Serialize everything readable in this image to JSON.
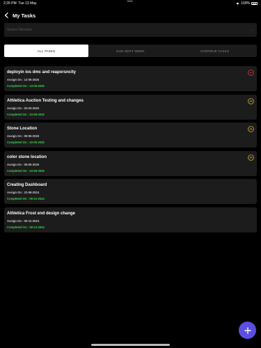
{
  "status_bar": {
    "time": "2:26 PM",
    "date": "Tue 13 May",
    "battery": "100%"
  },
  "header": {
    "title": "My Tasks"
  },
  "select_member": {
    "placeholder": "Select Member"
  },
  "tabs": [
    {
      "label": "ALL TASKS",
      "active": true
    },
    {
      "label": "DUE NEXT WEEK",
      "active": false
    },
    {
      "label": "OVERDUE TASKS",
      "active": false
    }
  ],
  "tasks": [
    {
      "title": "deployin ios dmc and reaporsncity",
      "assign": "Assign On : 12-05-2025",
      "completed": "Completed On : 13-05-2025",
      "icon": "cancel-circle-icon"
    },
    {
      "title": "Athletica Auction Testing and changes",
      "assign": "Assign On : 03-03-2025",
      "completed": "Completed On : 10-05-2025",
      "icon": "chevron-up-circle-icon"
    },
    {
      "title": "Stone Location",
      "assign": "Assign On : 09-05-2025",
      "completed": "Completed On : 10-05-2025",
      "icon": "chevron-up-circle-icon"
    },
    {
      "title": "color stone location",
      "assign": "Assign On : 09-05-2025",
      "completed": "Completed On : 10-05-2025",
      "icon": "chevron-up-circle-icon"
    },
    {
      "title": "Creating Dashboard",
      "assign": "Assign On : 22-08-2024",
      "completed": "Completed On : 09-12-2024",
      "icon": ""
    },
    {
      "title": "Athletica Frost end design change",
      "assign": "Assign On : 05-12-2024",
      "completed": "Completed On : 09-12-2024",
      "icon": ""
    }
  ],
  "colors": {
    "accent": "#5b4fe0",
    "completed": "#3bd14a",
    "cancel": "#e03a3a",
    "expand": "#e0b340"
  }
}
